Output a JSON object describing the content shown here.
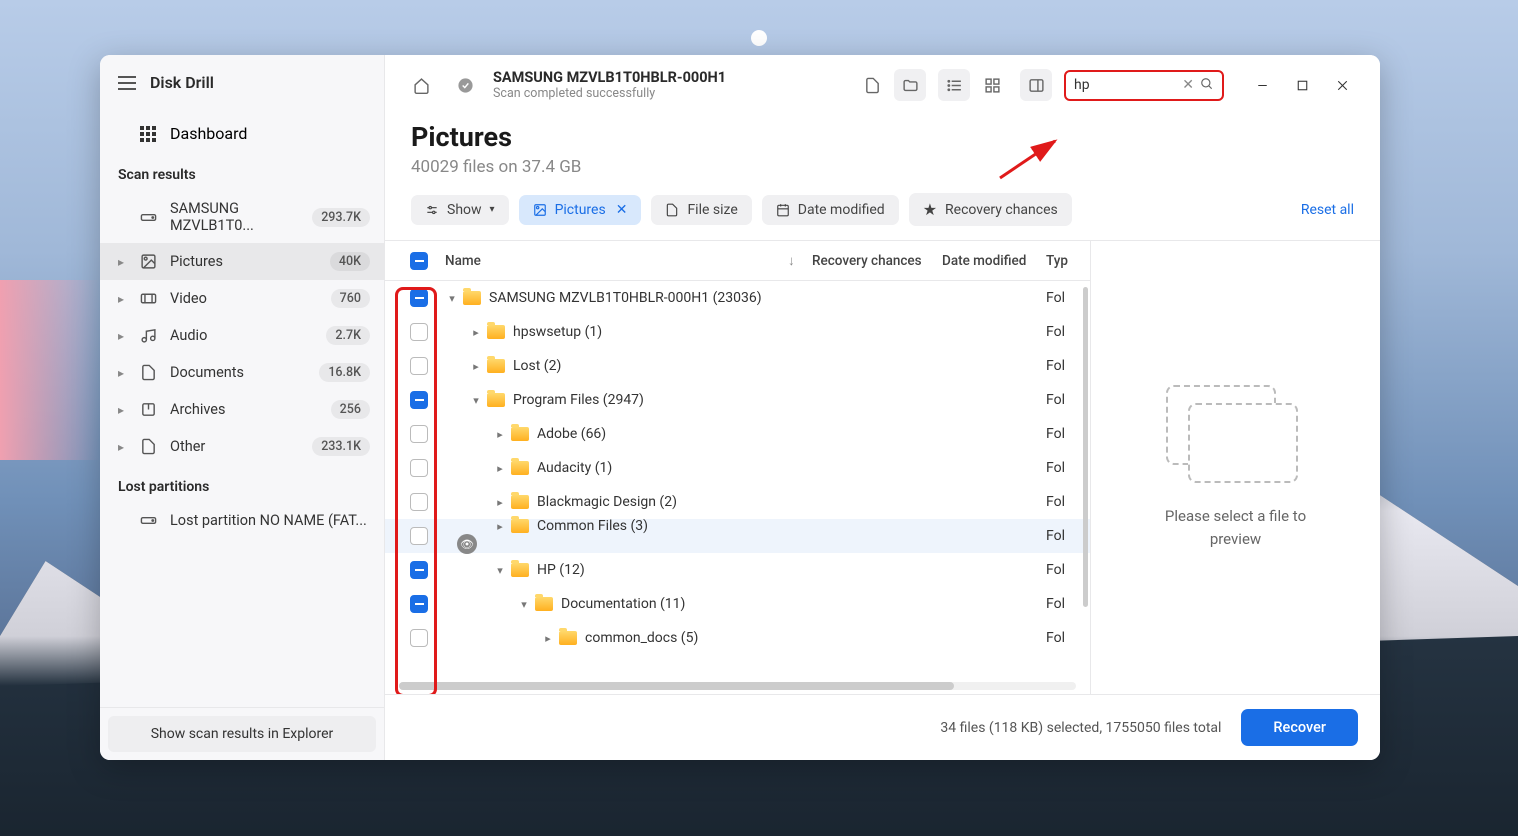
{
  "app": {
    "title": "Disk Drill"
  },
  "sidebar": {
    "dashboard": "Dashboard",
    "sections": {
      "scan_results": "Scan results",
      "lost_partitions": "Lost partitions"
    },
    "scan_items": [
      {
        "icon": "drive",
        "label": "SAMSUNG MZVLB1T0...",
        "badge": "293.7K",
        "chev": false,
        "active": false
      },
      {
        "icon": "picture",
        "label": "Pictures",
        "badge": "40K",
        "chev": true,
        "active": true
      },
      {
        "icon": "video",
        "label": "Video",
        "badge": "760",
        "chev": true,
        "active": false
      },
      {
        "icon": "audio",
        "label": "Audio",
        "badge": "2.7K",
        "chev": true,
        "active": false
      },
      {
        "icon": "document",
        "label": "Documents",
        "badge": "16.8K",
        "chev": true,
        "active": false
      },
      {
        "icon": "archive",
        "label": "Archives",
        "badge": "256",
        "chev": true,
        "active": false
      },
      {
        "icon": "other",
        "label": "Other",
        "badge": "233.1K",
        "chev": true,
        "active": false
      }
    ],
    "lost_items": [
      {
        "icon": "drive",
        "label": "Lost partition NO NAME (FAT..."
      }
    ],
    "footer_btn": "Show scan results in Explorer"
  },
  "topbar": {
    "title": "SAMSUNG MZVLB1T0HBLR-000H1",
    "subtitle": "Scan completed successfully",
    "search_value": "hp"
  },
  "page": {
    "title": "Pictures",
    "subtitle": "40029 files on 37.4 GB"
  },
  "filters": {
    "show": "Show",
    "pictures": "Pictures",
    "file_size": "File size",
    "date_modified": "Date modified",
    "recovery_chances": "Recovery chances",
    "reset": "Reset all"
  },
  "columns": {
    "name": "Name",
    "recovery": "Recovery chances",
    "date": "Date modified",
    "type": "Typ"
  },
  "rows": [
    {
      "checked": true,
      "indent": 0,
      "expand": "▾",
      "name": "SAMSUNG MZVLB1T0HBLR-000H1 (23036)",
      "type": "Fol",
      "hover": false,
      "eye": false
    },
    {
      "checked": false,
      "indent": 1,
      "expand": "▸",
      "name": "hpswsetup (1)",
      "type": "Fol",
      "hover": false,
      "eye": false
    },
    {
      "checked": false,
      "indent": 1,
      "expand": "▸",
      "name": "Lost (2)",
      "type": "Fol",
      "hover": false,
      "eye": false
    },
    {
      "checked": true,
      "indent": 1,
      "expand": "▾",
      "name": "Program Files (2947)",
      "type": "Fol",
      "hover": false,
      "eye": false
    },
    {
      "checked": false,
      "indent": 2,
      "expand": "▸",
      "name": "Adobe (66)",
      "type": "Fol",
      "hover": false,
      "eye": false
    },
    {
      "checked": false,
      "indent": 2,
      "expand": "▸",
      "name": "Audacity (1)",
      "type": "Fol",
      "hover": false,
      "eye": false
    },
    {
      "checked": false,
      "indent": 2,
      "expand": "▸",
      "name": "Blackmagic Design (2)",
      "type": "Fol",
      "hover": false,
      "eye": false
    },
    {
      "checked": false,
      "indent": 2,
      "expand": "▸",
      "name": "Common Files (3)",
      "type": "Fol",
      "hover": true,
      "eye": true
    },
    {
      "checked": true,
      "indent": 2,
      "expand": "▾",
      "name": "HP (12)",
      "type": "Fol",
      "hover": false,
      "eye": false
    },
    {
      "checked": true,
      "indent": 3,
      "expand": "▾",
      "name": "Documentation (11)",
      "type": "Fol",
      "hover": false,
      "eye": false
    },
    {
      "checked": false,
      "indent": 4,
      "expand": "▸",
      "name": "common_docs (5)",
      "type": "Fol",
      "hover": false,
      "eye": false
    }
  ],
  "header_checked": true,
  "preview": {
    "text1": "Please select a file to",
    "text2": "preview"
  },
  "status": {
    "text": "34 files (118 KB) selected, 1755050 files total",
    "recover": "Recover"
  }
}
